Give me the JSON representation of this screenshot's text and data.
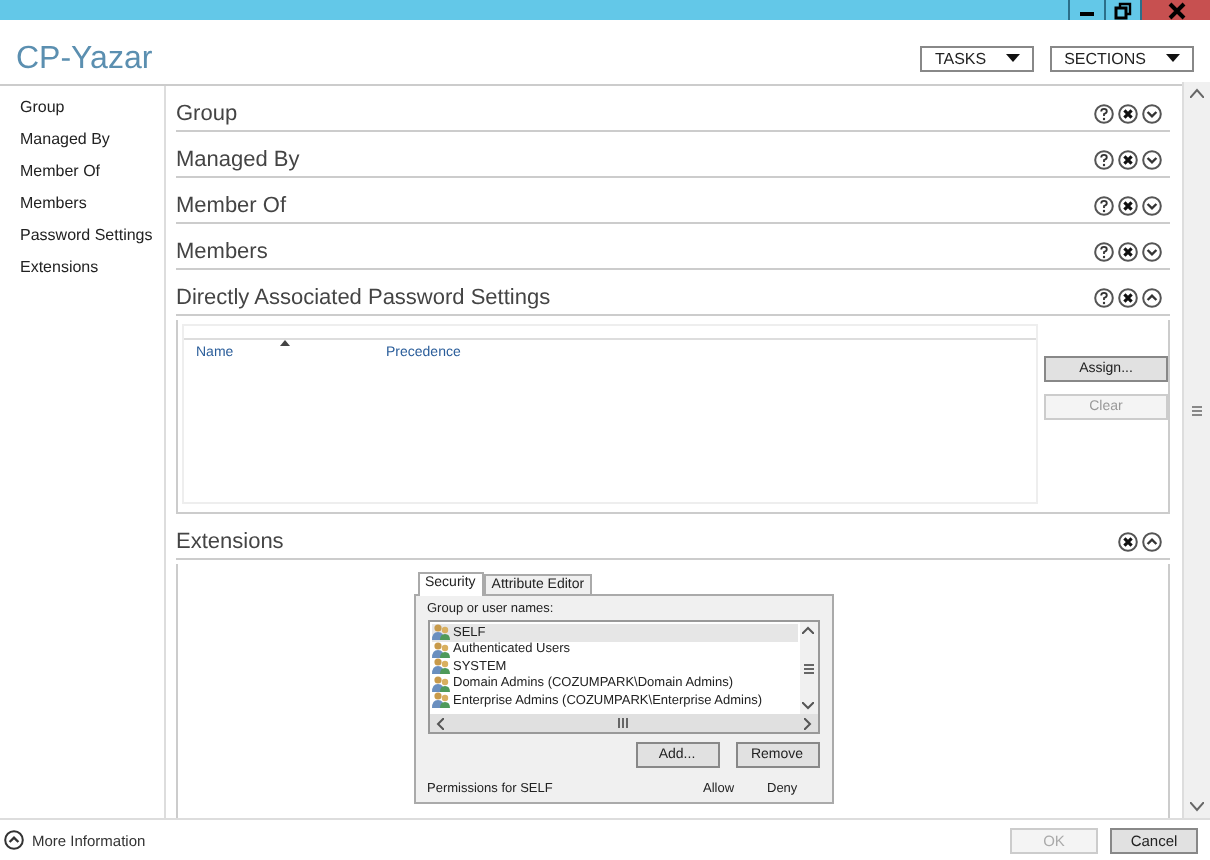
{
  "window": {
    "title": "CP-Yazar",
    "header_buttons": [
      {
        "label": "TASKS"
      },
      {
        "label": "SECTIONS"
      }
    ]
  },
  "sidebar": {
    "items": [
      {
        "label": "Group"
      },
      {
        "label": "Managed By"
      },
      {
        "label": "Member Of"
      },
      {
        "label": "Members"
      },
      {
        "label": "Password Settings"
      },
      {
        "label": "Extensions"
      }
    ]
  },
  "sections": [
    {
      "title": "Group",
      "help": true,
      "expanded": false
    },
    {
      "title": "Managed By",
      "help": true,
      "expanded": false
    },
    {
      "title": "Member Of",
      "help": true,
      "expanded": false
    },
    {
      "title": "Members",
      "help": true,
      "expanded": false
    },
    {
      "title": "Directly Associated Password Settings",
      "help": true,
      "expanded": true,
      "kind": "list",
      "columns": [
        "Name",
        "Precedence"
      ],
      "buttons": [
        {
          "label": "Assign...",
          "disabled": false
        },
        {
          "label": "Clear",
          "disabled": true
        }
      ]
    },
    {
      "title": "Extensions",
      "help": false,
      "expanded": true,
      "kind": "security",
      "tabs": [
        {
          "label": "Security",
          "selected": true
        },
        {
          "label": "Attribute Editor",
          "selected": false
        }
      ],
      "group_label": "Group or user names:",
      "users": [
        {
          "name": "SELF",
          "selected": true
        },
        {
          "name": "Authenticated Users",
          "selected": false
        },
        {
          "name": "SYSTEM",
          "selected": false
        },
        {
          "name": "Domain Admins (COZUMPARK\\Domain Admins)",
          "selected": false
        },
        {
          "name": "Enterprise Admins (COZUMPARK\\Enterprise Admins)",
          "selected": false
        }
      ],
      "user_buttons": [
        "Add...",
        "Remove"
      ],
      "permissions_label": "Permissions for SELF",
      "permission_columns": [
        "Allow",
        "Deny"
      ]
    }
  ],
  "footer": {
    "more_info": "More Information",
    "buttons": [
      {
        "label": "OK",
        "disabled": true
      },
      {
        "label": "Cancel",
        "disabled": false
      }
    ]
  }
}
